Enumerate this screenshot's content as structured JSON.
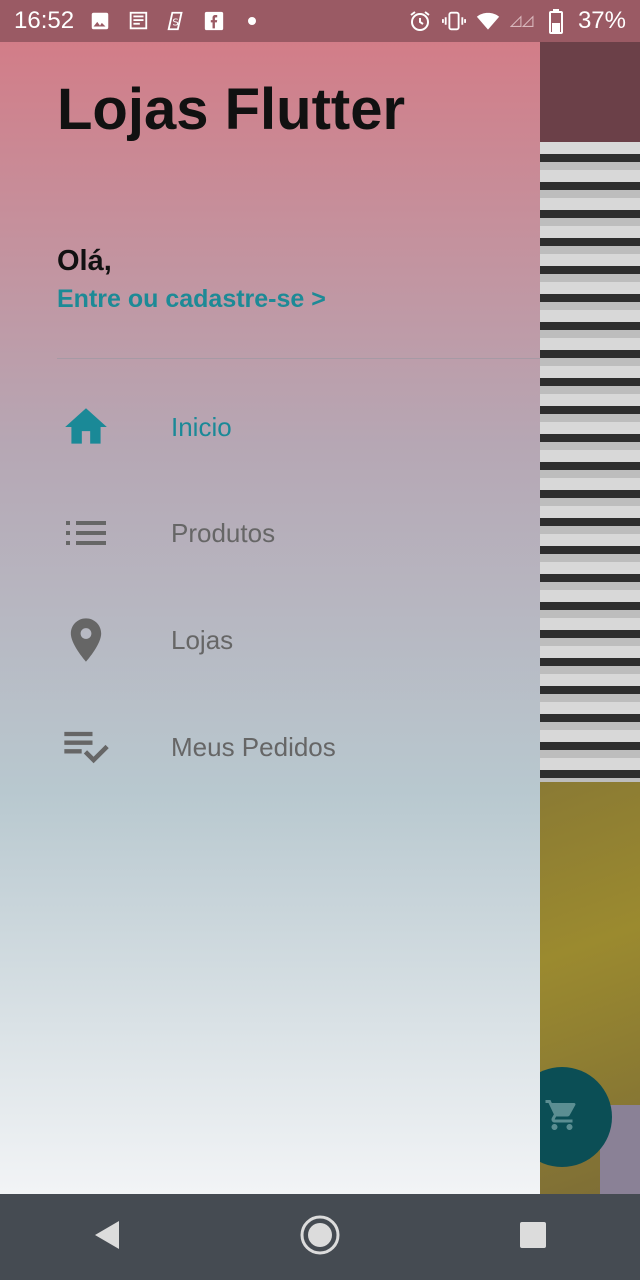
{
  "status_bar": {
    "time": "16:52",
    "battery": "37%",
    "left_icons": [
      "image-icon",
      "news-icon",
      "sync-icon",
      "facebook-icon",
      "dot-icon"
    ],
    "right_icons": [
      "alarm-icon",
      "vibrate-icon",
      "wifi-icon",
      "signal-icon",
      "battery-icon"
    ]
  },
  "drawer": {
    "title": "Lojas Flutter",
    "greeting": "Olá,",
    "login_link": "Entre ou cadastre-se >",
    "items": [
      {
        "label": "Inicio",
        "icon": "home-icon",
        "active": true
      },
      {
        "label": "Produtos",
        "icon": "list-icon",
        "active": false
      },
      {
        "label": "Lojas",
        "icon": "location-pin-icon",
        "active": false
      },
      {
        "label": "Meus Pedidos",
        "icon": "playlist-check-icon",
        "active": false
      }
    ]
  },
  "colors": {
    "accent": "#1a8997",
    "icon_gray": "#666666",
    "fab": "#0b4e55"
  },
  "nav_bar": {
    "buttons": [
      "back-icon",
      "home-circle-icon",
      "recents-icon"
    ]
  }
}
